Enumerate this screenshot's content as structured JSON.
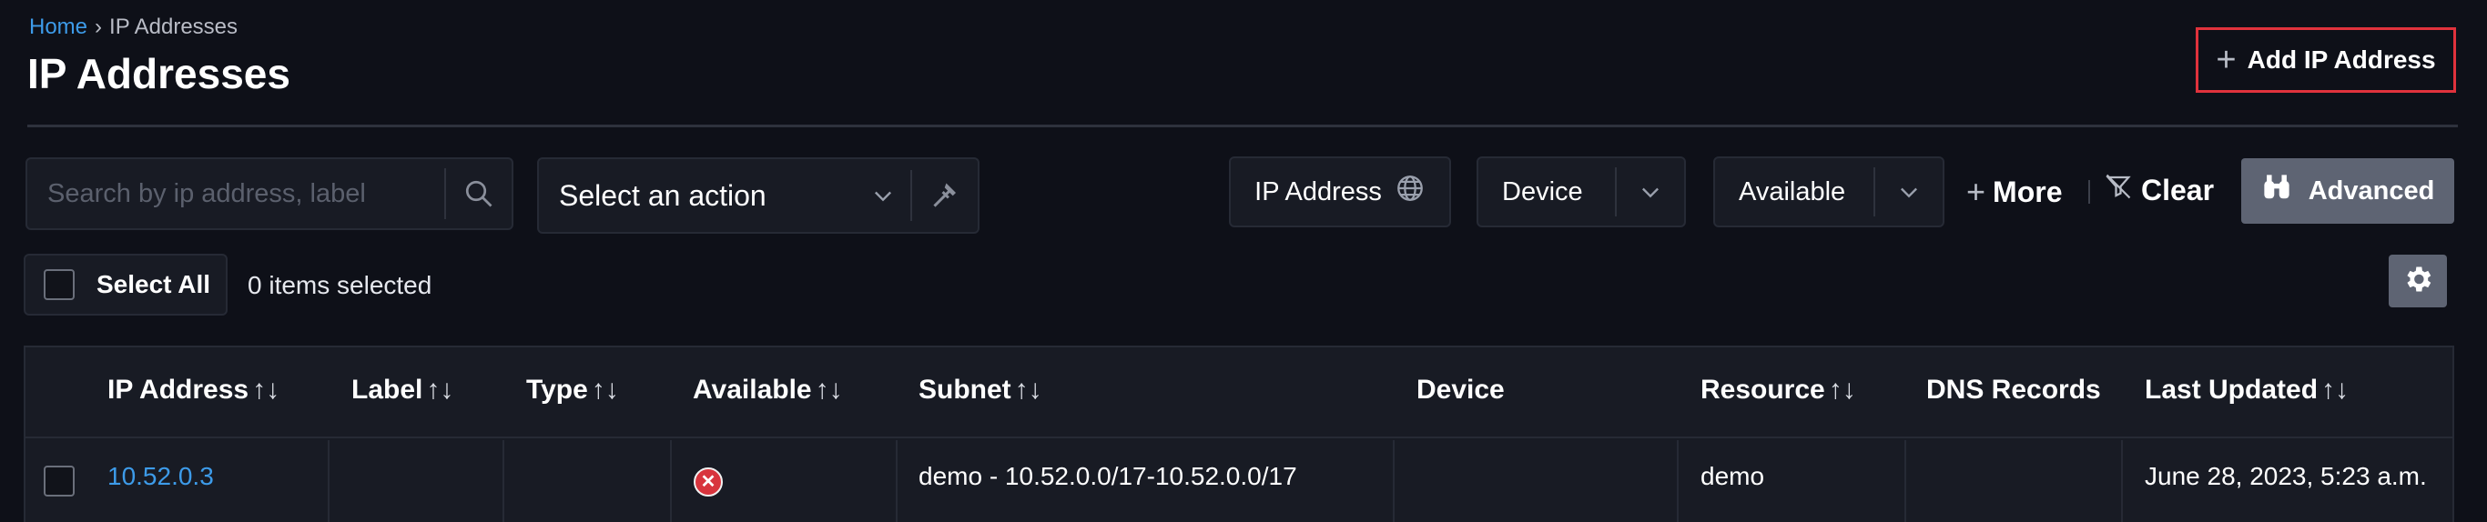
{
  "breadcrumb": {
    "home": "Home",
    "separator": "›",
    "current": "IP Addresses"
  },
  "page_title": "IP Addresses",
  "add_button": {
    "icon": "plus-icon",
    "label": "Add IP Address"
  },
  "search": {
    "placeholder": "Search by ip address, label",
    "value": "",
    "icon": "search-icon"
  },
  "action_select": {
    "label": "Select an action",
    "icon": "chevron-down-icon",
    "tool_icon": "hammer-icon"
  },
  "filters": {
    "ip_address": {
      "label": "IP Address",
      "icon": "globe-icon"
    },
    "device": {
      "label": "Device",
      "icon": "chevron-down-icon"
    },
    "available": {
      "label": "Available",
      "icon": "chevron-down-icon"
    },
    "more": {
      "icon": "plus-icon",
      "label": "More"
    },
    "clear": {
      "icon": "filter-clear-icon",
      "label": "Clear"
    },
    "advanced": {
      "icon": "binoculars-icon",
      "label": "Advanced"
    }
  },
  "selection": {
    "select_all_label": "Select All",
    "count_text": "0 items selected"
  },
  "settings": {
    "icon": "gear-icon"
  },
  "table": {
    "columns": [
      {
        "label": "IP Address",
        "sort": "↑↓"
      },
      {
        "label": "Label",
        "sort": "↑↓"
      },
      {
        "label": "Type",
        "sort": "↑↓"
      },
      {
        "label": "Available",
        "sort": "↑↓"
      },
      {
        "label": "Subnet",
        "sort": "↑↓"
      },
      {
        "label": "Device",
        "sort": ""
      },
      {
        "label": "Resource",
        "sort": "↑↓"
      },
      {
        "label": "DNS Records",
        "sort": ""
      },
      {
        "label": "Last Updated",
        "sort": "↑↓"
      }
    ],
    "rows": [
      {
        "ip_address": "10.52.0.3",
        "label": "",
        "type": "",
        "available": "no",
        "available_icon": "x-circle-icon",
        "subnet": "demo - 10.52.0.0/17-10.52.0.0/17",
        "device": "",
        "resource": "demo",
        "dns_records": "",
        "last_updated": "June 28, 2023, 5:23 a.m."
      }
    ]
  },
  "colors": {
    "accent_link": "#3d9be9",
    "highlight_border": "#e0323c",
    "status_unavailable": "#d8343d"
  }
}
